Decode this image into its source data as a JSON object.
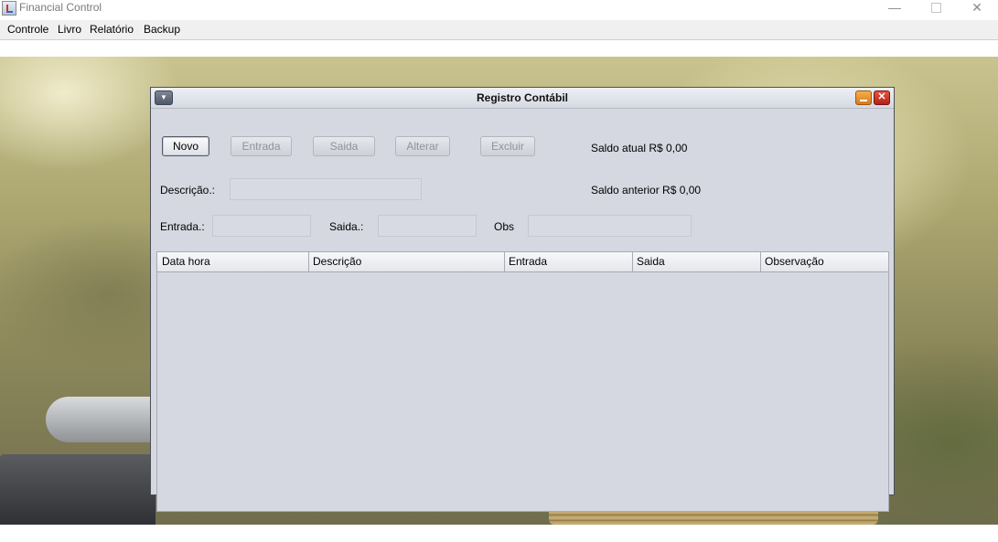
{
  "window": {
    "title": "Financial Control",
    "controls": {
      "minimize": "—",
      "close": "✕"
    }
  },
  "menu": [
    "Controle",
    "Livro",
    "Relatório",
    "Backup"
  ],
  "internal_frame": {
    "title": "Registro Contábil",
    "buttons": {
      "novo": "Novo",
      "entrada": "Entrada",
      "saida": "Saida",
      "alterar": "Alterar",
      "excluir": "Excluir"
    },
    "saldo_atual": "Saldo atual R$ 0,00",
    "saldo_anterior": "Saldo anterior R$ 0,00",
    "labels": {
      "descricao": "Descrição.:",
      "entrada": "Entrada.:",
      "saida": "Saida.:",
      "obs": "Obs"
    },
    "fields": {
      "descricao": "",
      "entrada": "",
      "saida": "",
      "obs": ""
    },
    "table": {
      "columns": [
        "Data hora",
        "Descrição",
        "Entrada",
        "Saida",
        "Observação"
      ],
      "rows": []
    }
  }
}
